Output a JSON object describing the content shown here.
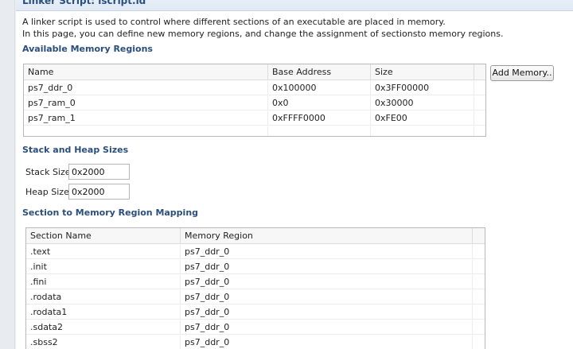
{
  "editor": {
    "title": "Linker Script: lscript.ld",
    "description_line1": "A linker script is used to control where different sections of an executable are placed in memory.",
    "description_line2": "In this page, you can define new memory regions, and change the assignment of sectionsto memory regions."
  },
  "memory_regions": {
    "title": "Available Memory Regions",
    "columns": [
      "Name",
      "Base Address",
      "Size"
    ],
    "rows": [
      {
        "name": "ps7_ddr_0",
        "base": "0x100000",
        "size": "0x3FF00000"
      },
      {
        "name": "ps7_ram_0",
        "base": "0x0",
        "size": "0x30000"
      },
      {
        "name": "ps7_ram_1",
        "base": "0xFFFF0000",
        "size": "0xFE00"
      }
    ],
    "add_button_label": "Add Memory.."
  },
  "stack_heap": {
    "title": "Stack and Heap Sizes",
    "stack_label": "Stack Size",
    "stack_value": "0x2000",
    "heap_label": "Heap Size",
    "heap_value": "0x2000"
  },
  "section_mapping": {
    "title": "Section to Memory Region Mapping",
    "columns": [
      "Section Name",
      "Memory Region"
    ],
    "rows": [
      {
        "section": ".text",
        "region": "ps7_ddr_0"
      },
      {
        "section": ".init",
        "region": "ps7_ddr_0"
      },
      {
        "section": ".fini",
        "region": "ps7_ddr_0"
      },
      {
        "section": ".rodata",
        "region": "ps7_ddr_0"
      },
      {
        "section": ".rodata1",
        "region": "ps7_ddr_0"
      },
      {
        "section": ".sdata2",
        "region": "ps7_ddr_0"
      },
      {
        "section": ".sbss2",
        "region": "ps7_ddr_0"
      }
    ]
  }
}
